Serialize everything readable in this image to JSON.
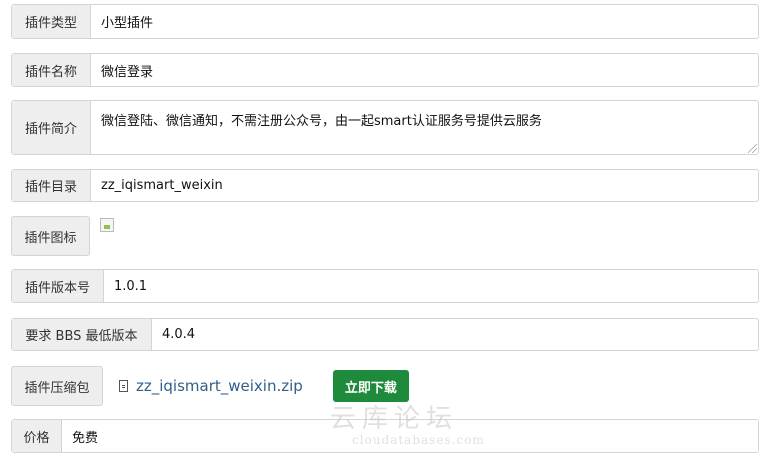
{
  "fields": {
    "type": {
      "label": "插件类型",
      "value": "小型插件"
    },
    "name": {
      "label": "插件名称",
      "value": "微信登录"
    },
    "intro": {
      "label": "插件简介",
      "value": "微信登陆、微信通知，不需注册公众号，由一起smart认证服务号提供云服务"
    },
    "dir": {
      "label": "插件目录",
      "value": "zz_iqismart_weixin"
    },
    "icon": {
      "label": "插件图标"
    },
    "version": {
      "label": "插件版本号",
      "value": "1.0.1"
    },
    "bbs_min": {
      "label": "要求 BBS 最低版本",
      "value": "4.0.4"
    },
    "package": {
      "label": "插件压缩包",
      "file_name": "zz_iqismart_weixin.zip",
      "download_label": "立即下载"
    },
    "price": {
      "label": "价格",
      "value": "免费"
    }
  },
  "watermark": {
    "main": "云库论坛",
    "sub": "cloudatabases.com"
  },
  "colors": {
    "download_button": "#1e8a3c",
    "label_bg": "#eeeeee",
    "link": "#2f5f8a"
  }
}
